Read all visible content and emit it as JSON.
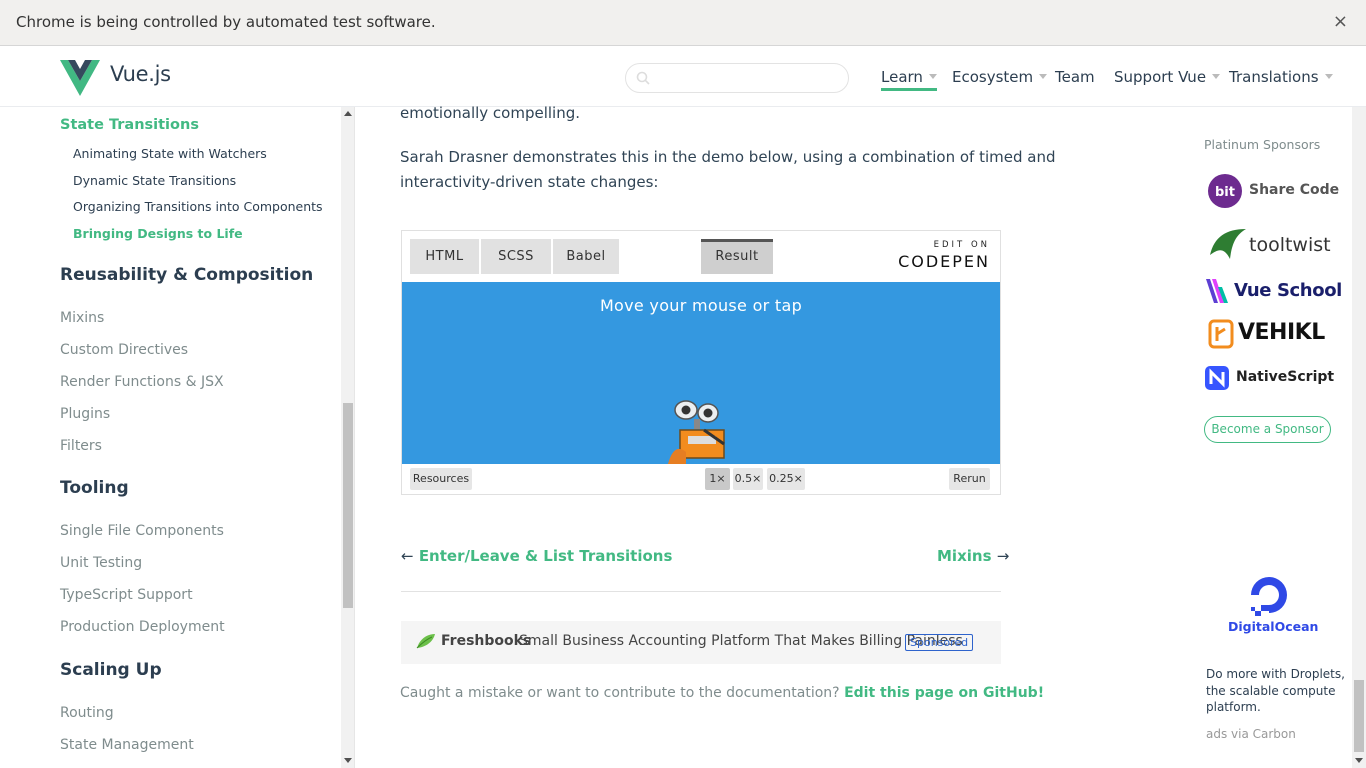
{
  "infobar": {
    "message": "Chrome is being controlled by automated test software.",
    "close": "×"
  },
  "header": {
    "brand": "Vue.js",
    "search_placeholder": "",
    "nav": [
      "Learn",
      "Ecosystem",
      "Team",
      "Support Vue",
      "Translations"
    ],
    "active_nav": "Learn",
    "accent_color": "#42b983"
  },
  "sidebar": {
    "current_section": "State Transitions",
    "sub_items": [
      "Animating State with Watchers",
      "Dynamic State Transitions",
      "Organizing Transitions into Components",
      "Bringing Designs to Life"
    ],
    "active_sub_item": "Bringing Designs to Life",
    "groups": [
      {
        "title": "Reusability & Composition",
        "items": [
          "Mixins",
          "Custom Directives",
          "Render Functions & JSX",
          "Plugins",
          "Filters"
        ]
      },
      {
        "title": "Tooling",
        "items": [
          "Single File Components",
          "Unit Testing",
          "TypeScript Support",
          "Production Deployment"
        ]
      },
      {
        "title": "Scaling Up",
        "items": [
          "Routing",
          "State Management"
        ]
      }
    ]
  },
  "main": {
    "para_tail": "emotionally compelling.",
    "para_line1": "Sarah Drasner demonstrates this in the demo below, using a combination of timed and",
    "para_line2": "interactivity-driven state changes:",
    "pen": {
      "tabs": [
        "HTML",
        "SCSS",
        "Babel"
      ],
      "result_tab": "Result",
      "edit_on": "EDIT ON",
      "codepen": "CODEPEN",
      "stage_text": "Move your mouse or tap",
      "stage_color": "#3498e0",
      "footer": {
        "resources": "Resources",
        "zoom": [
          "1×",
          "0.5×",
          "0.25×"
        ],
        "selected_zoom": "1×",
        "rerun": "Rerun"
      }
    },
    "prev": {
      "arrow": "←",
      "label": "Enter/Leave & List Transitions"
    },
    "next": {
      "arrow": "→",
      "label": "Mixins"
    },
    "carbon_ad": {
      "brand": "Freshbooks",
      "text": "Small Business Accounting Platform That Makes Billing Painless",
      "badge": "Sponsored"
    },
    "mistake": {
      "text": "Caught a mistake or want to contribute to the documentation?",
      "link": "Edit this page on GitHub!"
    }
  },
  "sponsors": {
    "title": "Platinum Sponsors",
    "items": [
      "Share Code",
      "tooltwist",
      "Vue School",
      "VEHIKL",
      "NativeScript"
    ],
    "become_button": "Become a Sponsor",
    "digitalocean": "DigitalOcean",
    "do_text": "Do more with Droplets, the scalable compute platform.",
    "via": "ads via Carbon"
  }
}
